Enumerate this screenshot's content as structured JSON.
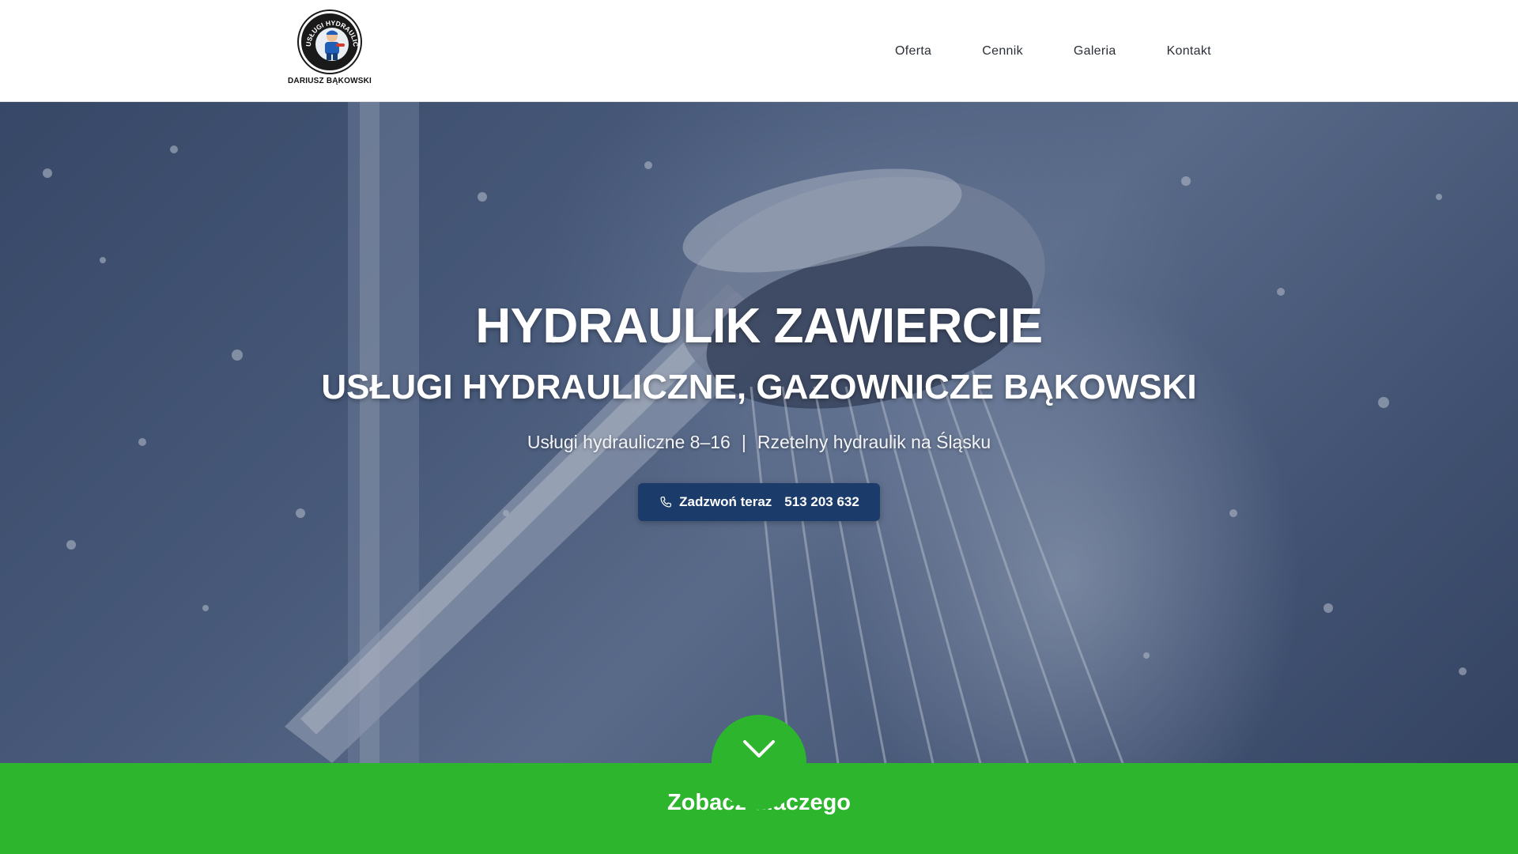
{
  "logo": {
    "ring_text": "USŁUGI HYDRAULICZNE",
    "caption": "DARIUSZ BĄKOWSKI"
  },
  "nav": {
    "items": [
      {
        "label": "Oferta"
      },
      {
        "label": "Cennik"
      },
      {
        "label": "Galeria"
      },
      {
        "label": "Kontakt"
      }
    ]
  },
  "hero": {
    "title": "HYDRAULIK ZAWIERCIE",
    "subtitle": "USŁUGI HYDRAULICZNE, GAZOWNICZE BĄKOWSKI",
    "tagline_left": "Usługi hydrauliczne 8–16",
    "tagline_separator": "|",
    "tagline_right": "Rzetelny hydraulik na Śląsku",
    "call_button": {
      "label": "Zadzwoń teraz",
      "phone": "513 203 632",
      "icon": "phone-icon"
    }
  },
  "see_why": {
    "label": "Zobacz dlaczego",
    "icon": "chevron-down-icon"
  },
  "colors": {
    "accent_green": "#2db52d",
    "button_navy": "#1b3c6b"
  }
}
